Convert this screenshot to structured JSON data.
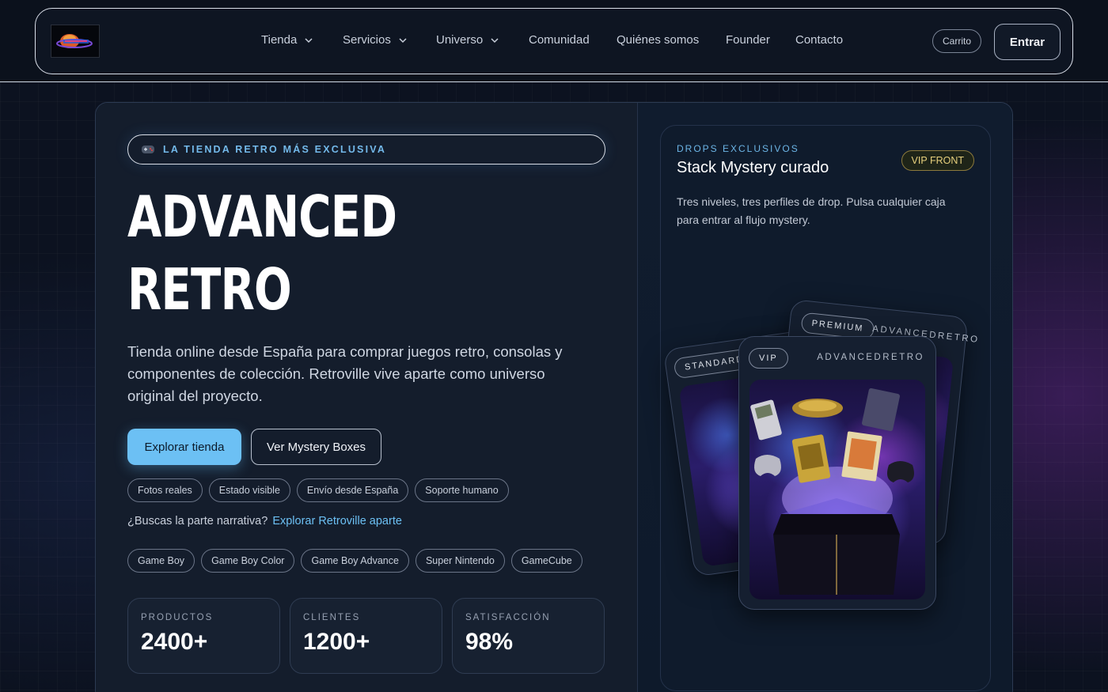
{
  "nav": {
    "logo_alt": "Advanced Retro",
    "links": [
      {
        "label": "Tienda",
        "dropdown": true
      },
      {
        "label": "Servicios",
        "dropdown": true
      },
      {
        "label": "Universo",
        "dropdown": true
      },
      {
        "label": "Comunidad",
        "dropdown": false
      },
      {
        "label": "Quiénes somos",
        "dropdown": false
      },
      {
        "label": "Founder",
        "dropdown": false
      },
      {
        "label": "Contacto",
        "dropdown": false
      }
    ],
    "cart_label": "Carrito",
    "login_label": "Entrar"
  },
  "hero": {
    "tag_label": "LA TIENDA RETRO MÁS EXCLUSIVA",
    "title_line1": "ADVANCED",
    "title_line2": "RETRO",
    "description": "Tienda online desde España para comprar juegos retro, consolas y componentes de colección. Retroville vive aparte como universo original del proyecto.",
    "primary_cta": "Explorar tienda",
    "secondary_cta": "Ver Mystery Boxes",
    "features": [
      "Fotos reales",
      "Estado visible",
      "Envío desde España",
      "Soporte humano"
    ],
    "narrative_question": "¿Buscas la parte narrativa?",
    "narrative_link": "Explorar Retroville aparte",
    "platforms": [
      "Game Boy",
      "Game Boy Color",
      "Game Boy Advance",
      "Super Nintendo",
      "GameCube"
    ],
    "stats": [
      {
        "label": "PRODUCTOS",
        "value": "2400+"
      },
      {
        "label": "CLIENTES",
        "value": "1200+"
      },
      {
        "label": "SATISFACCIÓN",
        "value": "98%"
      }
    ]
  },
  "drops": {
    "eyebrow": "DROPS EXCLUSIVOS",
    "title": "Stack Mystery curado",
    "badge": "VIP FRONT",
    "description": "Tres niveles, tres perfiles de drop. Pulsa cualquier caja para entrar al flujo mystery.",
    "boxes": [
      {
        "tier": "STANDARD"
      },
      {
        "tier": "PREMIUM",
        "brand": "ADVANCEDRETRO"
      },
      {
        "tier": "VIP",
        "brand": "ADVANCEDRETRO"
      }
    ]
  },
  "colors": {
    "accent": "#6cc0f4",
    "vip_gold": "#e6cf7c",
    "background": "#0c1220"
  }
}
